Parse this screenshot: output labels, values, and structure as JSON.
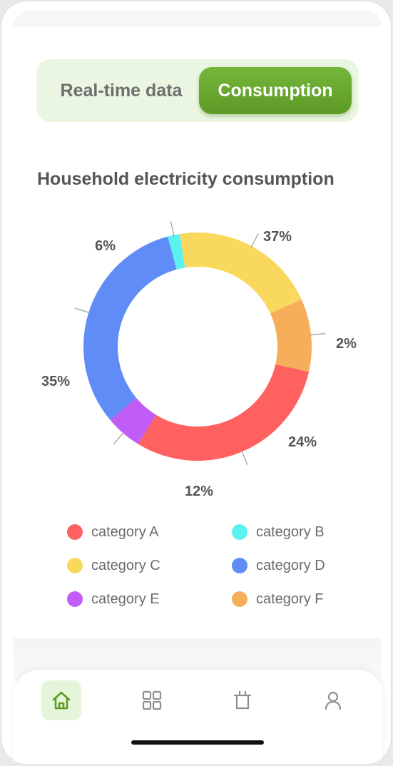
{
  "toggle": {
    "realtime_label": "Real-time data",
    "consumption_label": "Consumption",
    "selected": "Consumption"
  },
  "chart_data": {
    "type": "pie",
    "title": "Household electricity consumption",
    "donut": true,
    "categories": [
      "category A",
      "category B",
      "category C",
      "category D",
      "category E",
      "category F"
    ],
    "values": [
      35,
      2,
      24,
      37,
      6,
      12
    ],
    "labels": [
      "35%",
      "2%",
      "24%",
      "37%",
      "6%",
      "12%"
    ],
    "colors": [
      "#ff6161",
      "#5cf2f2",
      "#f8d95e",
      "#5f8cf6",
      "#c25cf6",
      "#f7ae5b"
    ],
    "legend": "bottom"
  },
  "legend": [
    {
      "label": "category A",
      "color": "#ff6161"
    },
    {
      "label": "category B",
      "color": "#5cf2f2"
    },
    {
      "label": "category C",
      "color": "#f8d95e"
    },
    {
      "label": "category D",
      "color": "#5f8cf6"
    },
    {
      "label": "category E",
      "color": "#c25cf6"
    },
    {
      "label": "category F",
      "color": "#f7ae5b"
    }
  ],
  "nav": {
    "items": [
      {
        "icon": "home-icon",
        "active": true
      },
      {
        "icon": "grid-icon",
        "active": false
      },
      {
        "icon": "plug-icon",
        "active": false
      },
      {
        "icon": "user-icon",
        "active": false
      }
    ],
    "accent": "#5e9a25"
  }
}
